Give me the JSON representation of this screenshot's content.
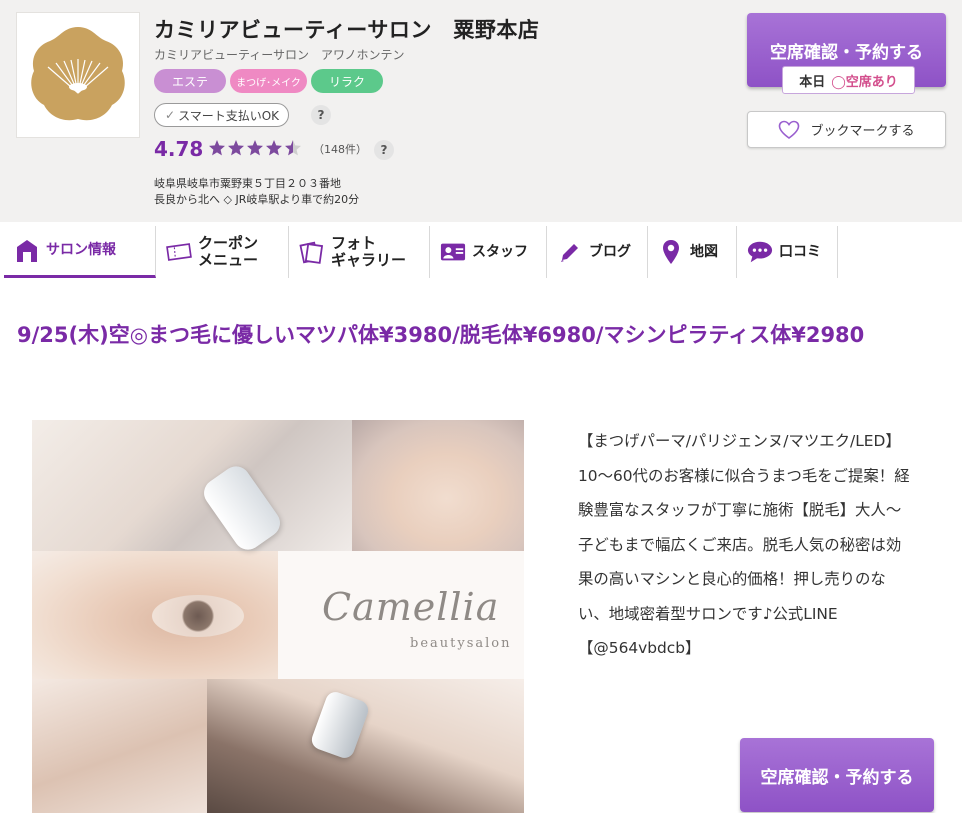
{
  "header": {
    "salon_name": "カミリアビューティーサロン　粟野本店",
    "salon_kana": "カミリアビューティーサロン　アワノホンテン",
    "tags": [
      "エステ",
      "まつげ･メイク",
      "リラク"
    ],
    "smart_pay": "スマート支払いOK",
    "help_symbol": "?",
    "rating": "4.78",
    "rating_stars": 4.5,
    "review_count": "（148件）",
    "address_line1": "岐阜県岐阜市粟野東５丁目２０３番地",
    "address_line2": "長良から北へ ◇ JR岐阜駅より車で約20分",
    "book_button": "空席確認・予約する",
    "vacancy_today": "本日",
    "vacancy_symbol": "◯",
    "vacancy_status": "空席あり",
    "bookmark_button": "ブックマークする",
    "colors": {
      "accent": "#7a2aa6",
      "button": "#9a60cf",
      "pink": "#d34f8d"
    }
  },
  "tabs": [
    {
      "label": "サロン情報",
      "icon": "home-icon"
    },
    {
      "label": "クーポン\nメニュー",
      "icon": "coupon-icon"
    },
    {
      "label": "フォト\nギャラリー",
      "icon": "photo-icon"
    },
    {
      "label": "スタッフ",
      "icon": "staff-icon"
    },
    {
      "label": "ブログ",
      "icon": "pencil-icon"
    },
    {
      "label": "地図",
      "icon": "map-pin-icon"
    },
    {
      "label": "口コミ",
      "icon": "chat-icon"
    }
  ],
  "main": {
    "headline": "9/25(木)空◎まつ毛に優しいマツパ体¥3980/脱毛体¥6980/マシンピラティス体¥2980",
    "hero_text_script": "Camellia",
    "hero_text_sub": "beautysalon",
    "description": "【まつげパーマ/パリジェンヌ/マツエク/LED】10～60代のお客様に似合うまつ毛をご提案！経験豊富なスタッフが丁寧に施術【脱毛】大人～子どもまで幅広くご来店。脱毛人気の秘密は効果の高いマシンと良心的価格！押し売りのない、地域密着型サロンです♪公式LINE【@564vbdcb】",
    "book_button": "空席確認・予約する"
  }
}
